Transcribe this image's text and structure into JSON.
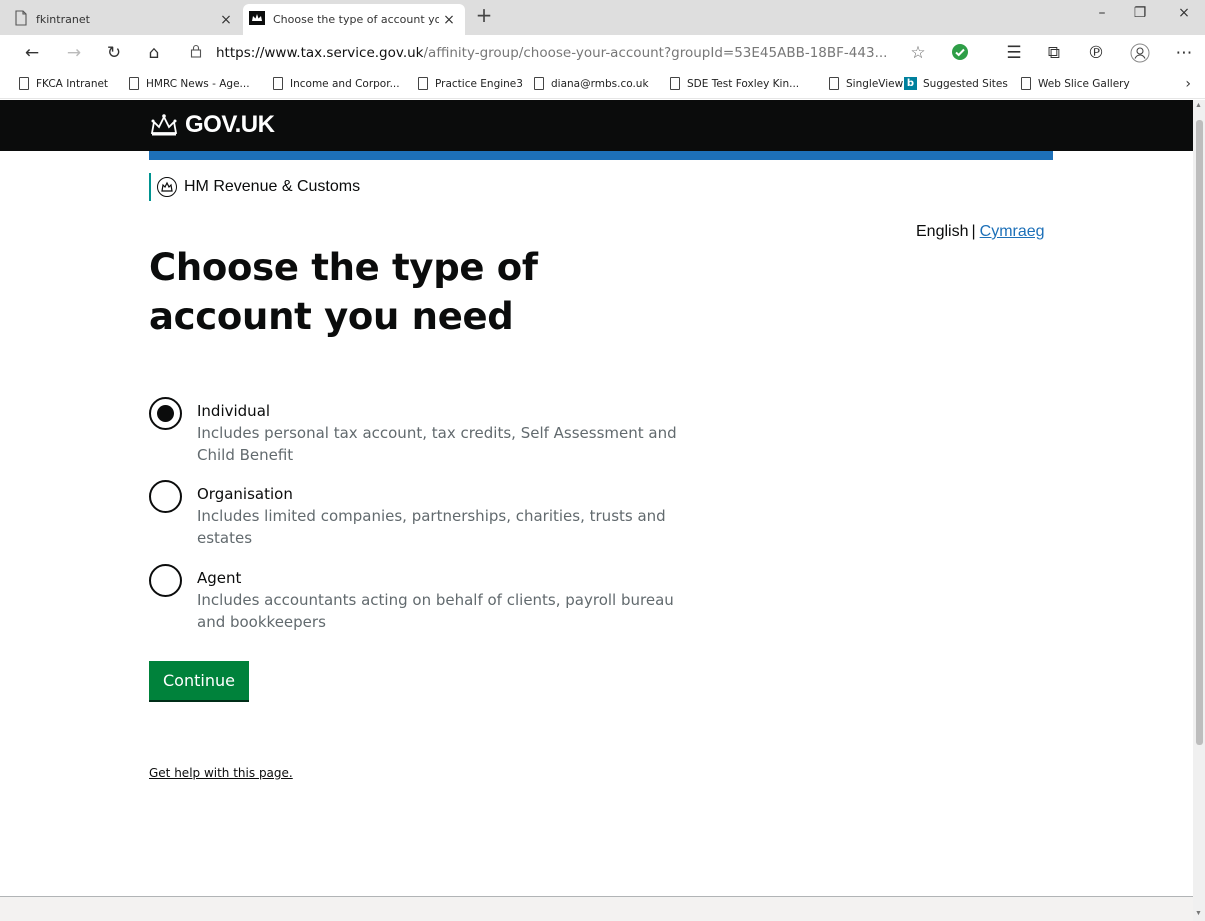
{
  "browser": {
    "tabs": [
      {
        "label": "fkintranet"
      },
      {
        "label": "Choose the type of account you"
      }
    ],
    "tab_close_glyph": "×",
    "new_tab_glyph": "+",
    "window_controls": {
      "minimize": "–",
      "restore": "❐",
      "close": "×"
    },
    "address": {
      "lock_glyph": "🔒",
      "host": "https://www.tax.service.gov.uk",
      "path": "/affinity-group/choose-your-account?groupId=53E45ABB-18BF-443..."
    },
    "favorites": [
      {
        "label": "FKCA Intranet",
        "icon": "page-icon"
      },
      {
        "label": "HMRC News - Age...",
        "icon": "page-icon"
      },
      {
        "label": "Income and Corpor...",
        "icon": "page-icon"
      },
      {
        "label": "Practice Engine3",
        "icon": "page-icon"
      },
      {
        "label": "diana@rmbs.co.uk",
        "icon": "page-icon"
      },
      {
        "label": "SDE Test Foxley Kin...",
        "icon": "page-icon"
      },
      {
        "label": "SingleView",
        "icon": "page-icon"
      },
      {
        "label": "Suggested Sites",
        "icon": "bing-icon"
      },
      {
        "label": "Web Slice Gallery",
        "icon": "page-icon"
      }
    ],
    "favorites_more_glyph": "›",
    "colors": {
      "tab_strip": "#dedede",
      "status_ok": "#2e9e47"
    }
  },
  "govuk": {
    "logo_text": "GOV.UK",
    "department": "HM Revenue & Customs",
    "colors": {
      "header": "#0b0c0c",
      "band": "#1d70b8",
      "hmrc_rule": "#009390",
      "button": "#00823b",
      "link": "#1d70b8"
    }
  },
  "language": {
    "current": "English",
    "separator": "|",
    "other": "Cymraeg"
  },
  "page": {
    "heading": "Choose the type of account you need",
    "options": [
      {
        "label": "Individual",
        "hint": "Includes personal tax account, tax credits, Self Assessment and Child Benefit",
        "selected": true
      },
      {
        "label": "Organisation",
        "hint": "Includes limited companies, partnerships, charities, trusts and estates",
        "selected": false
      },
      {
        "label": "Agent",
        "hint": "Includes accountants acting on behalf of clients, payroll bureau and bookkeepers",
        "selected": false
      }
    ],
    "continue_label": "Continue",
    "help_link": "Get help with this page."
  }
}
